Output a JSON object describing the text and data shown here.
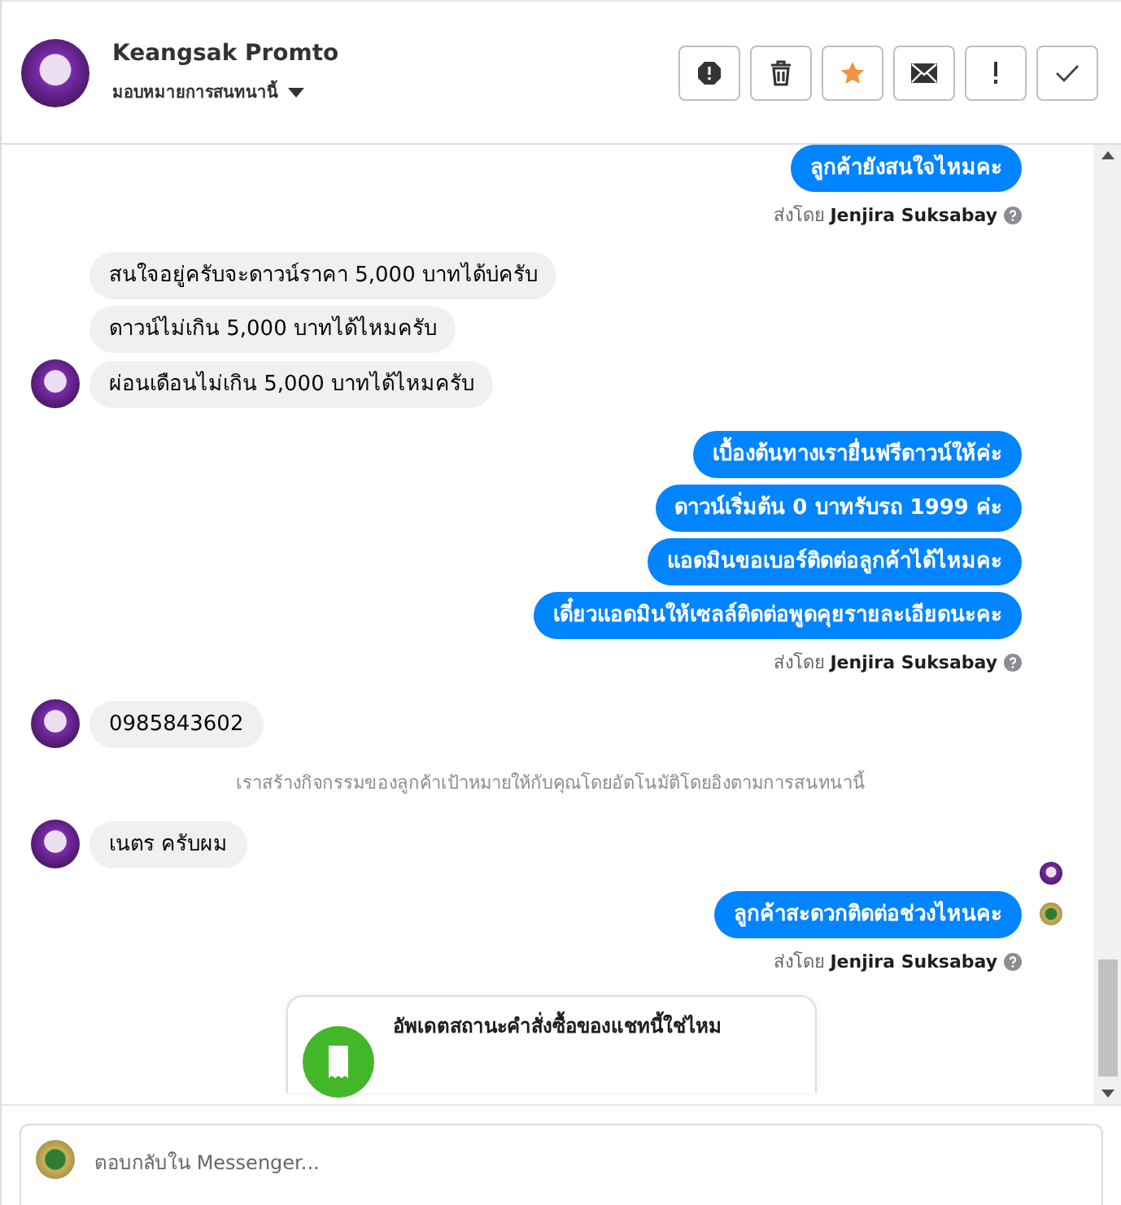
{
  "header": {
    "name": "Keangsak Promto",
    "assign_label": "มอบหมายการสนทนานี้",
    "actions": [
      {
        "kind": "spam"
      },
      {
        "kind": "delete"
      },
      {
        "kind": "star"
      },
      {
        "kind": "mail"
      },
      {
        "kind": "important"
      },
      {
        "kind": "done"
      }
    ]
  },
  "messages": [
    {
      "kind": "outgoing",
      "text": "ลูกค้ายังสนใจไหมคะ"
    },
    {
      "kind": "sent_by",
      "prefix": "ส่งโดย",
      "name": "Jenjira Suksabay"
    },
    {
      "kind": "incoming",
      "text": "สนใจอยู่ครับจะดาวน์ราคา 5,000 บาทได้บ่ครับ",
      "avatar": false
    },
    {
      "kind": "incoming",
      "text": "ดาวน์ไม่เกิน 5,000 บาทได้ไหมครับ",
      "avatar": false
    },
    {
      "kind": "incoming",
      "text": "ผ่อนเดือนไม่เกิน 5,000 บาทได้ไหมครับ",
      "avatar": true
    },
    {
      "kind": "outgoing",
      "text": "เบื้องต้นทางเรายื่นฟรีดาวน์ให้ค่ะ"
    },
    {
      "kind": "outgoing",
      "text": "ดาวน์เริ่มต้น 0 บาทรับรถ 1999 ค่ะ"
    },
    {
      "kind": "outgoing",
      "text": "แอดมินขอเบอร์ติดต่อลูกค้าได้ไหมคะ"
    },
    {
      "kind": "outgoing",
      "text": "เดี๋ยวแอดมินให้เซลล์ติดต่อพูดคุยรายละเอียดนะคะ"
    },
    {
      "kind": "sent_by",
      "prefix": "ส่งโดย",
      "name": "Jenjira Suksabay"
    },
    {
      "kind": "incoming",
      "text": "0985843602",
      "avatar": true
    },
    {
      "kind": "system",
      "text": "เราสร้างกิจกรรมของลูกค้าเป้าหมายให้กับคุณโดยอัตโนมัติโดยอิงตามการสนทนานี้"
    },
    {
      "kind": "incoming",
      "text": "เนตร ครับผม",
      "avatar": true,
      "seen": true
    },
    {
      "kind": "outgoing",
      "text": "ลูกค้าสะดวกติดต่อช่วงไหนคะ",
      "page_avatar": true
    },
    {
      "kind": "sent_by",
      "prefix": "ส่งโดย",
      "name": "Jenjira Suksabay"
    },
    {
      "kind": "card",
      "title": "อัพเดตสถานะคำสั่งซื้อของแชทนี้ใช่ไหม"
    }
  ],
  "composer": {
    "placeholder": "ตอบกลับใน Messenger..."
  }
}
